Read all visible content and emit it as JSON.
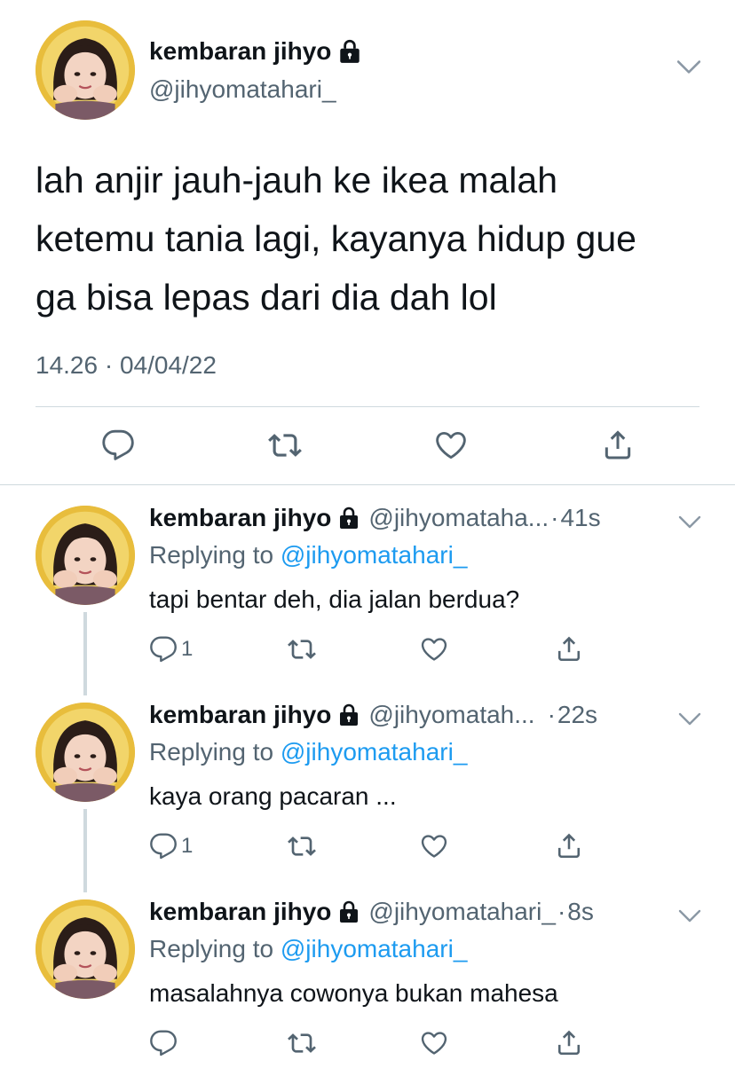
{
  "main_tweet": {
    "display_name": "kembaran jihyo",
    "handle": "@jihyomatahari_",
    "text_lines": [
      "lah anjir jauh-jauh ke ikea malah",
      "ketemu tania lagi, kayanya hidup gue",
      "ga bisa lepas dari dia dah lol"
    ],
    "timestamp": "14.26 · 04/04/22"
  },
  "replies": [
    {
      "display_name": "kembaran jihyo",
      "handle": "@jihyomataha...",
      "dot": "·",
      "time": "41s",
      "replying_prefix": "Replying to",
      "replying_to": "@jihyomatahari_",
      "text": "tapi bentar deh, dia jalan berdua?",
      "reply_count": "1"
    },
    {
      "display_name": "kembaran jihyo",
      "handle": "@jihyomatah...",
      "dot": "·",
      "time": "22s",
      "replying_prefix": "Replying to",
      "replying_to": "@jihyomatahari_",
      "text": "kaya orang pacaran ...",
      "reply_count": "1"
    },
    {
      "display_name": "kembaran jihyo",
      "handle": "@jihyomatahari_",
      "dot": "·",
      "time": "8s",
      "replying_prefix": "Replying to",
      "replying_to": "@jihyomatahari_",
      "text": "masalahnya cowonya bukan mahesa",
      "reply_count": ""
    }
  ],
  "icons": {
    "reply": "speech-bubble-icon",
    "retweet": "retweet-icon",
    "like": "heart-icon",
    "share": "share-icon",
    "lock": "lock-icon",
    "more": "chevron-down-icon"
  },
  "colors": {
    "link": "#1d9bf0",
    "secondary_text": "#536471",
    "divider": "#cfd9de"
  }
}
